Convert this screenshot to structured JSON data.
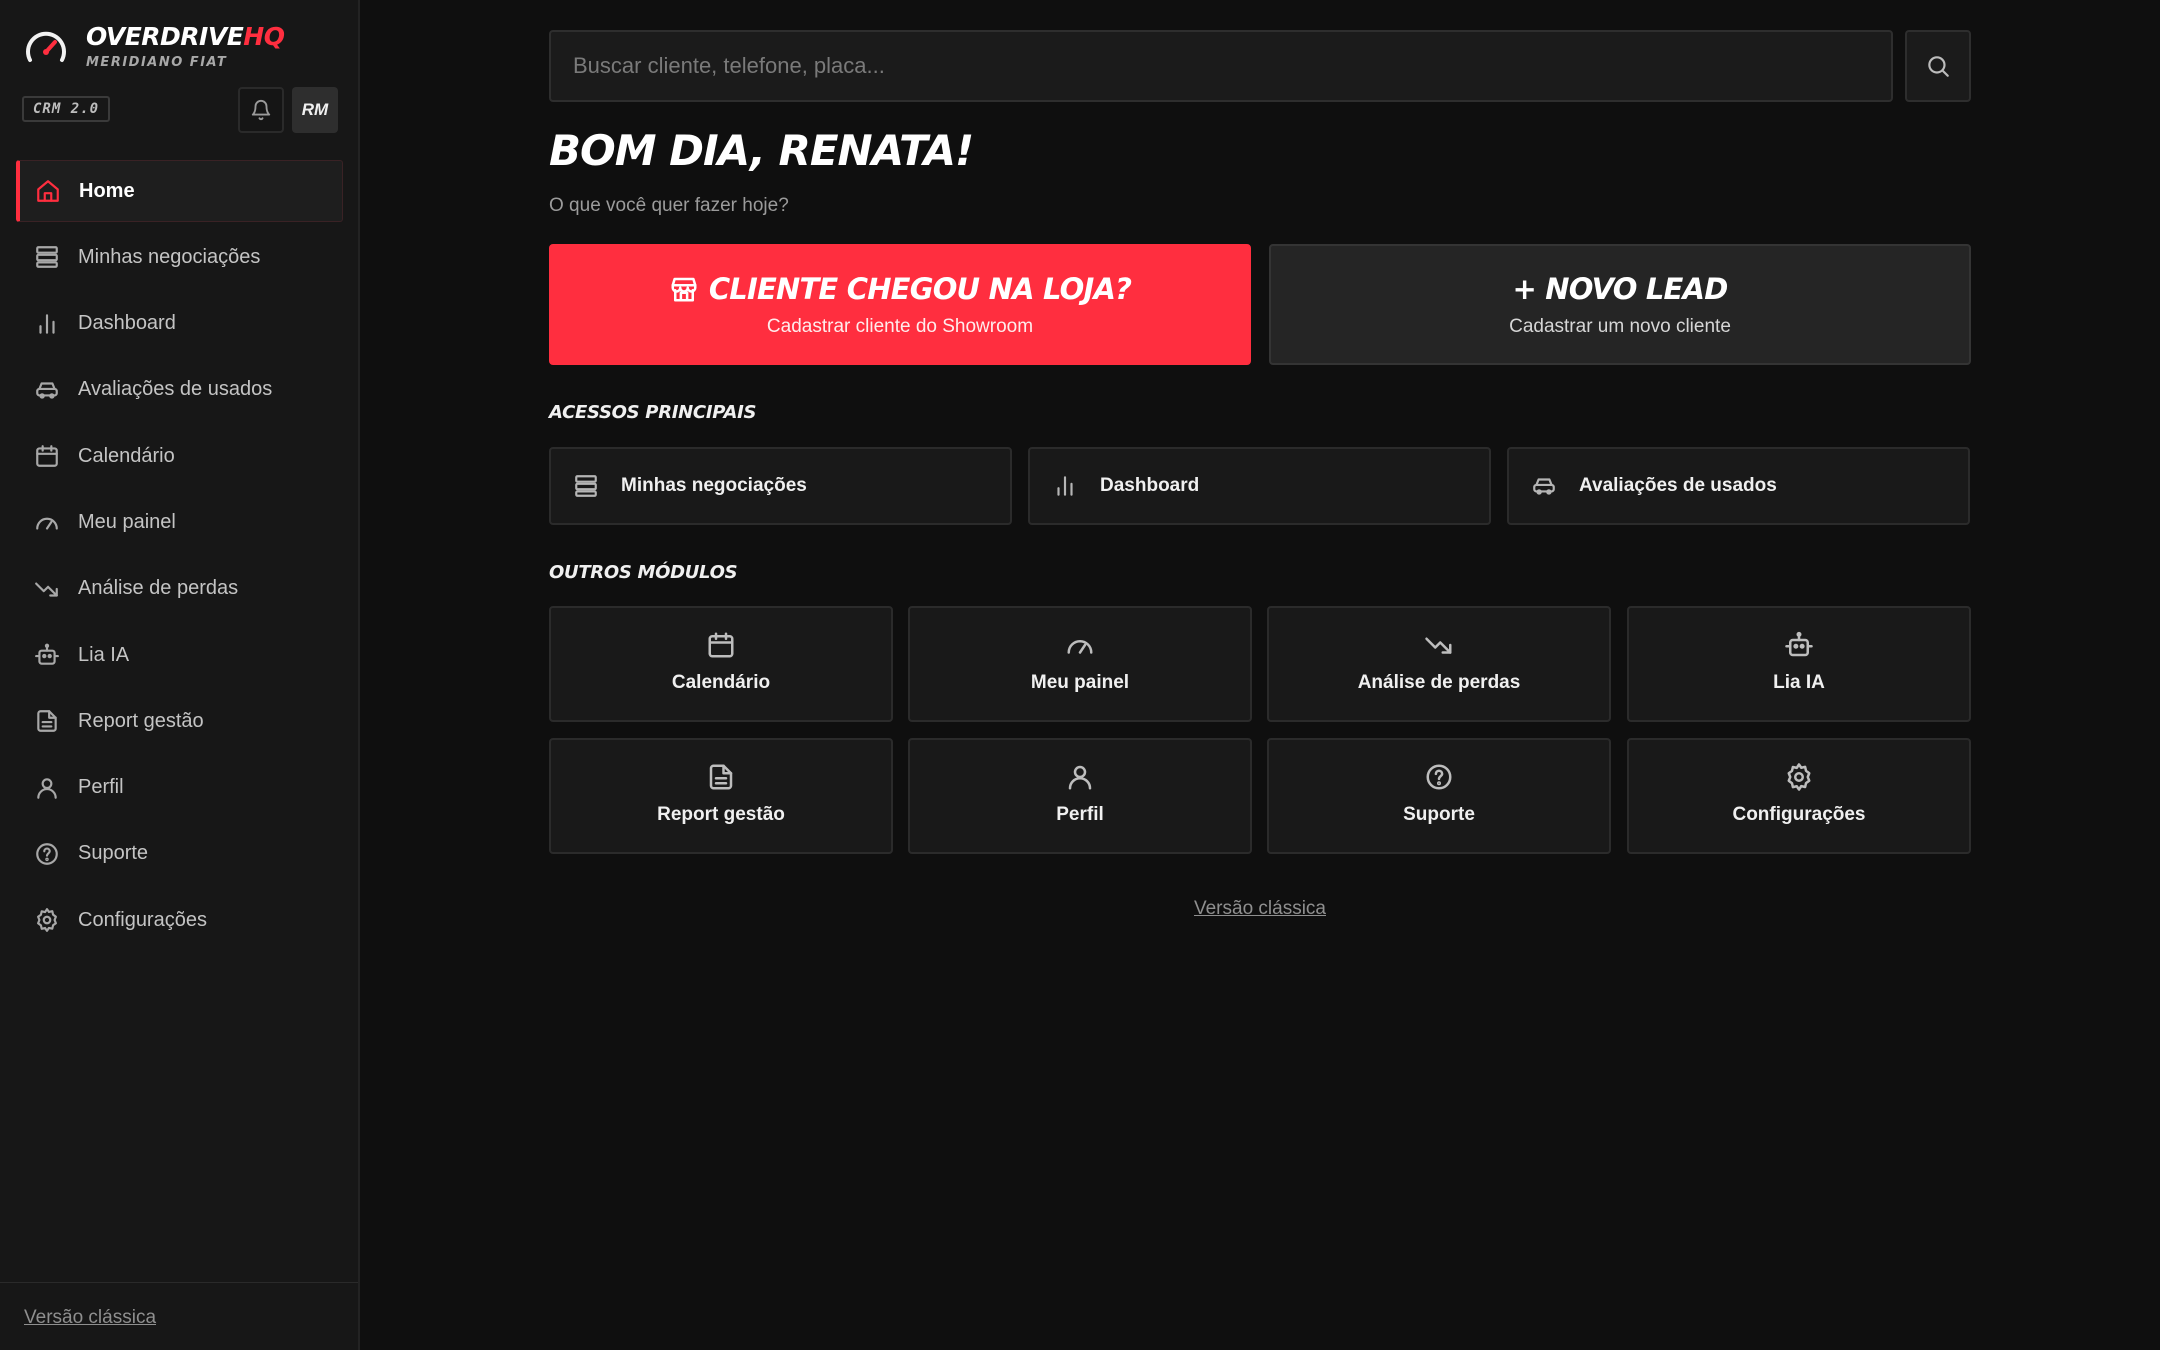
{
  "brand": {
    "name_main": "OVERDRIVE",
    "name_accent": "HQ",
    "subtitle": "MERIDIANO FIAT",
    "version_badge": "CRM 2.0"
  },
  "user": {
    "initials": "RM"
  },
  "colors": {
    "accent": "#ff2e3f",
    "background": "#0f0f0f",
    "sidebar": "#171717"
  },
  "sidebar": {
    "items": [
      {
        "label": "Home",
        "icon": "home-icon",
        "active": true
      },
      {
        "label": "Minhas negociações",
        "icon": "stack-icon"
      },
      {
        "label": "Dashboard",
        "icon": "bar-chart-icon"
      },
      {
        "label": "Avaliações de usados",
        "icon": "car-icon"
      },
      {
        "label": "Calendário",
        "icon": "calendar-icon"
      },
      {
        "label": "Meu painel",
        "icon": "gauge-icon"
      },
      {
        "label": "Análise de perdas",
        "icon": "trending-down-icon"
      },
      {
        "label": "Lia IA",
        "icon": "robot-icon"
      },
      {
        "label": "Report gestão",
        "icon": "document-icon"
      },
      {
        "label": "Perfil",
        "icon": "user-icon"
      },
      {
        "label": "Suporte",
        "icon": "help-circle-icon"
      },
      {
        "label": "Configurações",
        "icon": "gear-icon"
      }
    ],
    "footer_link": "Versão clássica"
  },
  "search": {
    "placeholder": "Buscar cliente, telefone, placa...",
    "value": ""
  },
  "greeting": {
    "title": "BOM DIA, RENATA!",
    "subtitle": "O que você quer fazer hoje?"
  },
  "cta": {
    "showroom": {
      "title": "CLIENTE CHEGOU NA LOJA?",
      "subtitle": "Cadastrar cliente do Showroom",
      "icon": "store-icon"
    },
    "lead": {
      "title": "+ NOVO LEAD",
      "subtitle": "Cadastrar um novo cliente"
    }
  },
  "main_access": {
    "label": "ACESSOS PRINCIPAIS",
    "items": [
      {
        "label": "Minhas negociações",
        "icon": "stack-icon"
      },
      {
        "label": "Dashboard",
        "icon": "bar-chart-icon"
      },
      {
        "label": "Avaliações de usados",
        "icon": "car-icon"
      }
    ]
  },
  "other_modules": {
    "label": "OUTROS MÓDULOS",
    "items": [
      {
        "label": "Calendário",
        "icon": "calendar-icon"
      },
      {
        "label": "Meu painel",
        "icon": "gauge-icon"
      },
      {
        "label": "Análise de perdas",
        "icon": "trending-down-icon"
      },
      {
        "label": "Lia IA",
        "icon": "robot-icon"
      },
      {
        "label": "Report gestão",
        "icon": "document-icon"
      },
      {
        "label": "Perfil",
        "icon": "user-icon"
      },
      {
        "label": "Suporte",
        "icon": "help-circle-icon"
      },
      {
        "label": "Configurações",
        "icon": "gear-icon"
      }
    ]
  },
  "footer": {
    "classic_link": "Versão clássica"
  }
}
